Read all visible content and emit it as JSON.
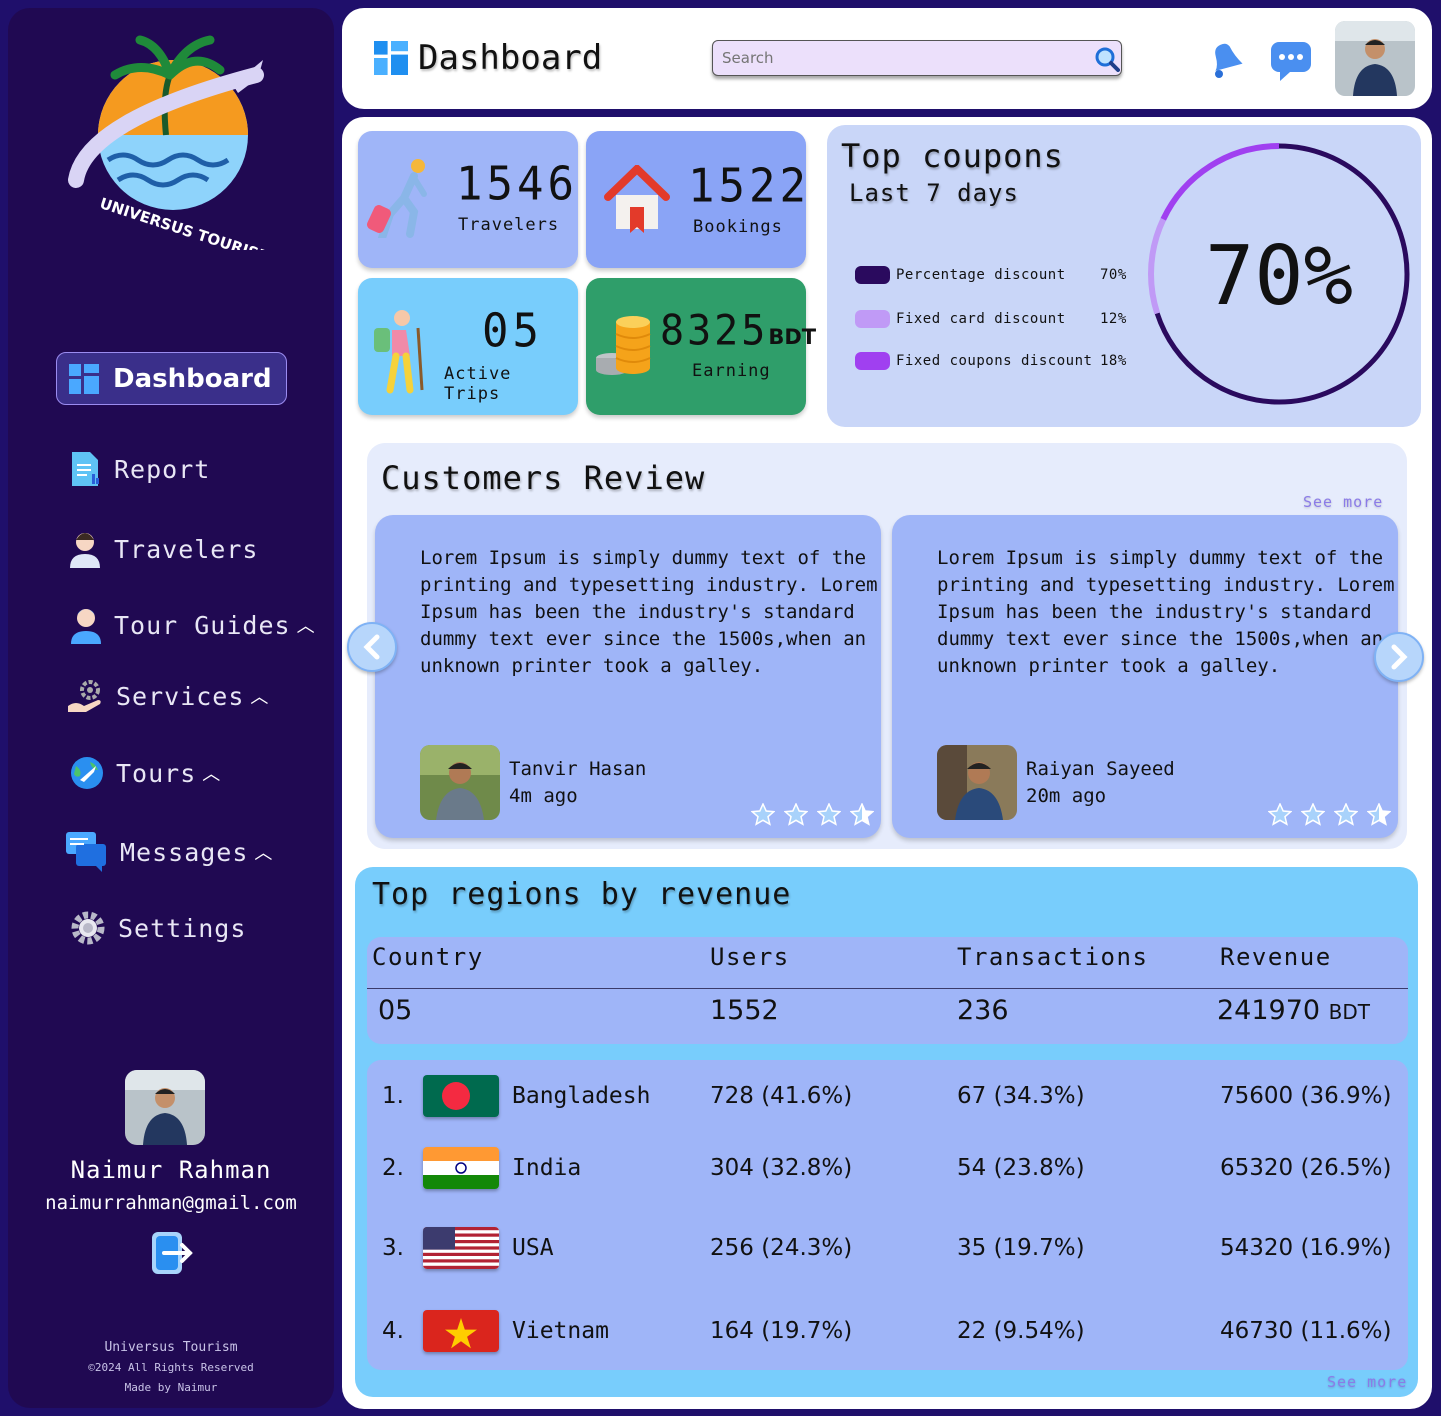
{
  "brand": {
    "logo_text": "UNIVERSUS TOURISM"
  },
  "sidebar": {
    "active": {
      "label": "Dashboard",
      "icon": "dashboard-icon"
    },
    "items": [
      {
        "label": "Report",
        "icon": "report-icon",
        "expandable": false
      },
      {
        "label": "Travelers",
        "icon": "traveler-icon",
        "expandable": false
      },
      {
        "label": "Tour Guides",
        "icon": "tour-guide-icon",
        "expandable": true
      },
      {
        "label": "Services",
        "icon": "services-icon",
        "expandable": true
      },
      {
        "label": "Tours",
        "icon": "globe-plane-icon",
        "expandable": true
      },
      {
        "label": "Messages",
        "icon": "messages-icon",
        "expandable": true
      },
      {
        "label": "Settings",
        "icon": "gear-icon",
        "expandable": false
      }
    ],
    "profile": {
      "name": "Naimur Rahman",
      "email": "naimurrahman@gmail.com"
    },
    "footer": {
      "brand": "Universus Tourism",
      "copyright": "©2024 All Rights Reserved",
      "made_by": "Made by Naimur"
    }
  },
  "header": {
    "title": "Dashboard",
    "search_placeholder": "Search"
  },
  "stats": {
    "travelers": {
      "value": "1546",
      "label": "Travelers"
    },
    "bookings": {
      "value": "1522",
      "label": "Bookings"
    },
    "trips": {
      "value": "05",
      "label": "Active Trips"
    },
    "earning": {
      "value": "8325",
      "unit": "BDT",
      "label": "Earning"
    }
  },
  "coupons": {
    "title": "Top coupons",
    "subtitle": "Last 7 days",
    "total": "70%",
    "items": [
      {
        "label": "Percentage discount",
        "value": "70%",
        "color": "#2a0a5e"
      },
      {
        "label": "Fixed card discount",
        "value": "12%",
        "color": "#c09af6"
      },
      {
        "label": "Fixed coupons discount",
        "value": "18%",
        "color": "#a040f0"
      }
    ]
  },
  "reviews": {
    "title": "Customers Review",
    "see_more": "See more",
    "items": [
      {
        "text": "Lorem Ipsum is simply dummy text of the printing and typesetting industry. Lorem Ipsum has been the industry's standard dummy text ever since the 1500s,when an unknown printer took a galley.",
        "name": "Tanvir Hasan",
        "time": "4m ago",
        "rating": 4
      },
      {
        "text": "Lorem Ipsum is simply dummy text of the printing and typesetting industry. Lorem Ipsum has been the industry's standard dummy text ever since the 1500s,when an unknown printer took a galley.",
        "name": "Raiyan Sayeed",
        "time": "20m ago",
        "rating": 4
      }
    ]
  },
  "regions": {
    "title": "Top regions by revenue",
    "see_more": "See more",
    "columns": [
      "Country",
      "Users",
      "Transactions",
      "Revenue"
    ],
    "summary": {
      "country": "05",
      "users": "1552",
      "transactions": "236",
      "revenue": "241970",
      "unit": "BDT"
    },
    "rows": [
      {
        "rank": "1.",
        "country": "Bangladesh",
        "users": "728 (41.6%)",
        "transactions": "67 (34.3%)",
        "revenue": "75600 (36.9%)"
      },
      {
        "rank": "2.",
        "country": "India",
        "users": "304 (32.8%)",
        "transactions": "54 (23.8%)",
        "revenue": "65320 (26.5%)"
      },
      {
        "rank": "3.",
        "country": "USA",
        "users": "256 (24.3%)",
        "transactions": "35 (19.7%)",
        "revenue": "54320 (16.9%)"
      },
      {
        "rank": "4.",
        "country": "Vietnam",
        "users": "164 (19.7%)",
        "transactions": "22 (9.54%)",
        "revenue": "46730 (11.6%)"
      }
    ]
  }
}
